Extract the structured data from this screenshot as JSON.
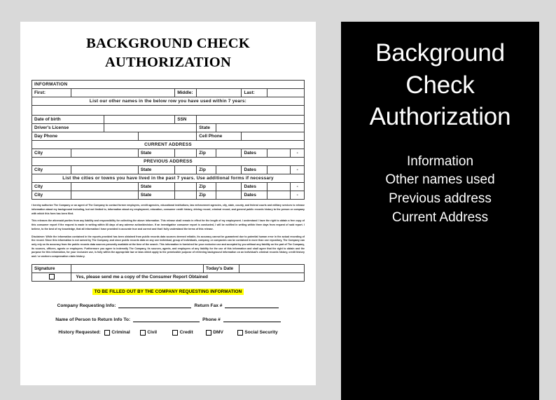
{
  "page": {
    "background_color": "#d9d9d9",
    "paper_color": "#ffffff"
  },
  "document": {
    "title_line1": "BACKGROUND CHECK",
    "title_line2": "AUTHORIZATION",
    "sections": {
      "information_header": "INFORMATION",
      "other_names_header": "List our other names in the below row you have used within 7 years:",
      "current_address_header": "CURRENT ADDRESS",
      "previous_address_header": "PREVIOUS ADDRESS",
      "cities_header": "List the cities or towns you have lived in the past 7 years. Use additional forms if necessary"
    },
    "labels": {
      "first": "First:",
      "middle": "Middle:",
      "last": "Last:",
      "date_of_birth": "Date of birth",
      "ssn": "SSN",
      "drivers_license": "Driver's License",
      "state": "State",
      "day_phone": "Day Phone",
      "cell_phone": "Cell Phone",
      "city": "City",
      "zip": "Zip",
      "dates": "Dates",
      "dates_dash": "-",
      "signature": "Signature",
      "todays_date": "Today's Date"
    },
    "consent_row": {
      "checkbox_checked": false,
      "text": "Yes, please send me a copy of the Consumer Report Obtained"
    },
    "legal": {
      "paragraph1": "I hereby authorize The Company or an agent of The Company to contact former employers, credit agencies, educational institutions, law enforcement agencies, city, state, county, and federal courts and military services to release information about my background including, but not limited to, information about my employment, education, consumer credit history, driving record, criminal record, and general public records history to the person or company with which this form has been filed.",
      "paragraph2": "This releases the aforesaid parties from any liability and responsibility for collecting the above information. This release shall remain in effect for the length of my employment. I understand I have the right to obtain a free copy of this consumer report if the request is made in writing within 60 days of any adverse action/decision. If an investigative consumer report is conducted, I will be notified in writing within three days from request of said report. I believe, to the best of my knowledge, that all information I have provided is accurate true and correct and that I fully understand the terms of this release.",
      "disclaimer_label": "Disclaimer:",
      "paragraph3": " While the information contained in the reports provided has been obtained from public records data sources deemed reliable, its accuracy cannot be guaranteed due to potential human error in the actual recording of the record. Since this information is not owned by The Company, and since public records data on any one individual, group of individuals, company, or companies can be contained in more than one repository, The Company can only rely on its accuracy from the public records data sources presently available at the time of the search. This information is furnished for your exclusive use and accepted by you without any liability on the part of The Company, its sources, officers, agents or employees. Furthermore you agree to indemnify The Company, its sources, agents, and employees of any liability for the use of this information and shall agree that the right to obtain and the purpose for this information, for your exclusive use, is fully within the appropriate law or laws which apply to the permissible purpose of retrieving background information on an individual's criminal records history, credit history and / or workers compensation claim history."
    },
    "highlight_banner": {
      "text": "TO BE FILLED OUT BY THE COMPANY REQUESTING INFORMATION",
      "background_color": "#ffff00",
      "text_color": "#000000"
    },
    "request_block": {
      "company_requesting_label": "Company Requesting Info:",
      "return_fax_label": "Return Fax #",
      "person_return_label": "Name of Person to Return Info To:",
      "phone_label": "Phone #",
      "history_requested_label": "History Requested:",
      "history_options": [
        {
          "label": "Criminal",
          "checked": false
        },
        {
          "label": "Civil",
          "checked": false
        },
        {
          "label": "Credit",
          "checked": false
        },
        {
          "label": "DMV",
          "checked": false
        },
        {
          "label": "Social Security",
          "checked": false
        }
      ]
    }
  },
  "panel": {
    "background_color": "#000000",
    "text_color": "#ffffff",
    "title_line1": "Background",
    "title_line2": "Check",
    "title_line3": "Authorization",
    "list": [
      "Information",
      "Other names used",
      "Previous address",
      "Current Address"
    ]
  }
}
